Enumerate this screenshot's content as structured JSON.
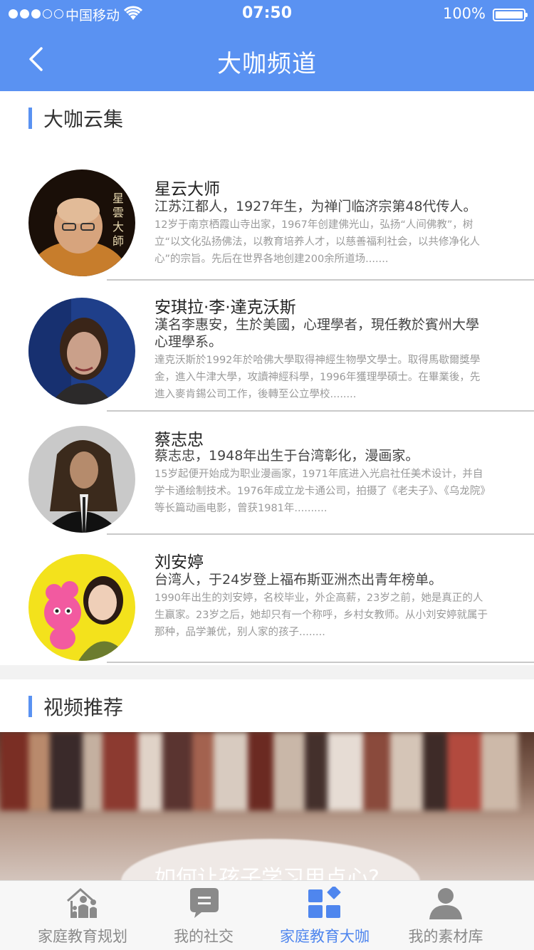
{
  "status": {
    "carrier": "中国移动",
    "time": "07:50",
    "battery": "100%"
  },
  "nav": {
    "title": "大咖频道"
  },
  "section1": {
    "title": "大咖云集"
  },
  "people": [
    {
      "name": "星云大师",
      "summary": "江苏江都人，1927年生，为禅门临济宗第48代传人。",
      "desc": "12岁于南京栖霞山寺出家，1967年创建佛光山，弘扬“人间佛教”，树立“以文化弘扬佛法，以教育培养人才，以慈善福利社会，以共修净化人心”的宗旨。先后在世界各地创建200余所道场.......",
      "avatar_text": "星雲大師"
    },
    {
      "name": "安琪拉·李·達克沃斯",
      "summary": "漢名李惠安，生於美國，心理學者，現任教於賓州大學心理學系。",
      "desc": "達克沃斯於1992年於哈佛大學取得神經生物學文學士。取得馬歇爾獎學金，進入牛津大學，攻讀神經科學，1996年獲理學碩士。在畢業後，先進入麥肯錫公司工作，後轉至公立學校........"
    },
    {
      "name": "蔡志忠",
      "summary": "蔡志忠，1948年出生于台湾彰化，漫画家。",
      "desc": "15岁起便开始成为职业漫画家，1971年底进入光启社任美术设计，并自学卡通绘制技术。1976年成立龙卡通公司，拍摄了《老夫子》、《乌龙院》等长篇动画电影，曾获1981年.........."
    },
    {
      "name": "刘安婷",
      "summary": "台湾人，于24岁登上福布斯亚洲杰出青年榜单。",
      "desc": "1990年出生的刘安婷，名校毕业，外企高薪，23岁之前，她是真正的人生赢家。23岁之后，她却只有一个称呼，乡村女教师。从小刘安婷就属于那种，品学兼优，别人家的孩子........"
    }
  ],
  "section2": {
    "title": "视频推荐"
  },
  "video": {
    "caption": "如何让孩子学习用点心?"
  },
  "tabs": [
    {
      "label": "家庭教育规划",
      "icon": "house-family-icon"
    },
    {
      "label": "我的社交",
      "icon": "chat-bubble-icon"
    },
    {
      "label": "家庭教育大咖",
      "icon": "grid-icon"
    },
    {
      "label": "我的素材库",
      "icon": "person-icon"
    }
  ],
  "colors": {
    "primary": "#5a92f2",
    "active_tab": "#4f86ee",
    "inactive_tab": "#8a8a8a"
  }
}
